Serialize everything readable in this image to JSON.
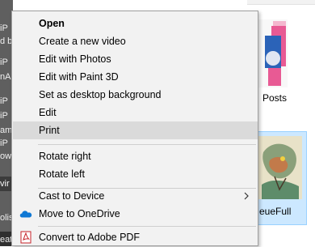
{
  "left_panel": {
    "items": [
      "iP",
      "d bi",
      "iP",
      "nA",
      "iP",
      "iP",
      "am",
      "iP",
      "ow",
      "vir",
      "olis",
      "eat"
    ]
  },
  "explorer": {
    "thumbnails": [
      {
        "label": "Posts"
      },
      {
        "label": "eueFull"
      }
    ]
  },
  "context_menu": {
    "items": [
      {
        "label": "Open"
      },
      {
        "label": "Create a new video"
      },
      {
        "label": "Edit with Photos"
      },
      {
        "label": "Edit with Paint 3D"
      },
      {
        "label": "Set as desktop background"
      },
      {
        "label": "Edit"
      },
      {
        "label": "Print"
      },
      {
        "label": "Rotate right"
      },
      {
        "label": "Rotate left"
      },
      {
        "label": "Cast to Device"
      },
      {
        "label": "Move to OneDrive"
      },
      {
        "label": "Convert to Adobe PDF"
      }
    ],
    "hovered": "Print",
    "icons": {
      "onedrive": "cloud-icon",
      "adobe": "adobe-pdf-icon",
      "cast_submenu": "chevron-right-icon"
    }
  },
  "colors": {
    "menu_bg": "#f2f2f2",
    "hover": "#dadada",
    "selection_bg": "#cce8ff",
    "onedrive_blue": "#0f78d4",
    "adobe_red": "#c7232a"
  }
}
